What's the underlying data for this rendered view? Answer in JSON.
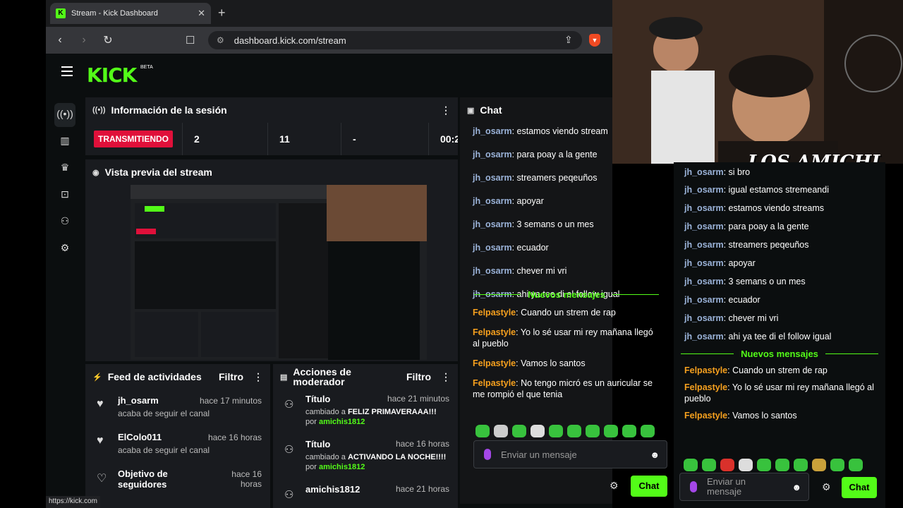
{
  "browser": {
    "tab_title": "Stream - Kick Dashboard",
    "url": "dashboard.kick.com/stream",
    "status_url": "https://kick.com"
  },
  "header": {
    "logo": "KICK",
    "beta": "BETA"
  },
  "session": {
    "title": "Información de la sesión",
    "live_label": "TRANSMITIENDO",
    "stat1": "2",
    "stat2": "11",
    "stat3": "-",
    "stat4": "00:2"
  },
  "preview": {
    "title": "Vista previa del stream"
  },
  "feed": {
    "title": "Feed de actividades",
    "filter": "Filtro",
    "items": [
      {
        "name": "jh_osarm",
        "time": "hace 17 minutos",
        "sub": "acaba de seguir el canal"
      },
      {
        "name": "ElColo011",
        "time": "hace 16 horas",
        "sub": "acaba de seguir el canal"
      },
      {
        "name": "Objetivo de seguidores",
        "time": "hace 16 horas",
        "sub": ""
      }
    ]
  },
  "mod": {
    "title": "Acciones de moderador",
    "filter": "Filtro",
    "items": [
      {
        "name": "Título",
        "time": "hace 21 minutos",
        "pre": "cambiado a ",
        "value": "FELIZ PRIMAVERAAA!!!",
        "by_pre": "por ",
        "by": "amichis1812"
      },
      {
        "name": "Título",
        "time": "hace 16 horas",
        "pre": "cambiado a ",
        "value": "ACTIVANDO LA NOCHE!!!!",
        "by_pre": " por ",
        "by": "amichis1812"
      }
    ],
    "partial_name": "amichis1812",
    "partial_time": "hace 21 horas"
  },
  "chat": {
    "title": "Chat",
    "messages": [
      {
        "user": "jh_osarm",
        "text": ": estamos viendo stream"
      },
      {
        "user": "jh_osarm",
        "text": ": para poay a la gente"
      },
      {
        "user": "jh_osarm",
        "text": ": streamers peqeuños"
      },
      {
        "user": "jh_osarm",
        "text": ": apoyar"
      },
      {
        "user": "jh_osarm",
        "text": ": 3 semans o un mes"
      },
      {
        "user": "jh_osarm",
        "text": ": ecuador"
      },
      {
        "user": "jh_osarm",
        "text": ": chever mi vri"
      },
      {
        "user": "jh_osarm",
        "text": ": ahi ya tee di el follow igual"
      }
    ],
    "new_label": "Nuevos mensajes",
    "new_messages": [
      {
        "user": "Felpastyle",
        "text": ": Cuando un strem de rap"
      },
      {
        "user": "Felpastyle",
        "text": ": Yo lo sé usar mi rey mañana llegó al pueblo"
      },
      {
        "user": "Felpastyle",
        "text": ": Vamos lo santos"
      },
      {
        "user": "Felpastyle",
        "text": ": No tengo micró es un auricular se me rompió el que tenia"
      }
    ],
    "placeholder": "Enviar un mensaje",
    "send": "Chat"
  },
  "overlay": {
    "title": "LOS AMICHI",
    "messages": [
      {
        "user": "jh_osarm",
        "text": ": si bro"
      },
      {
        "user": "jh_osarm",
        "text": ": igual estamos stremeandi"
      },
      {
        "user": "jh_osarm",
        "text": ": estamos viendo streams"
      },
      {
        "user": "jh_osarm",
        "text": ": para poay a la gente"
      },
      {
        "user": "jh_osarm",
        "text": ": streamers peqeuños"
      },
      {
        "user": "jh_osarm",
        "text": ": apoyar"
      },
      {
        "user": "jh_osarm",
        "text": ": 3 semans o un mes"
      },
      {
        "user": "jh_osarm",
        "text": ": ecuador"
      },
      {
        "user": "jh_osarm",
        "text": ": chever mi vri"
      },
      {
        "user": "jh_osarm",
        "text": ": ahi ya tee di el follow igual"
      }
    ],
    "new_label": "Nuevos mensajes",
    "new_messages": [
      {
        "user": "Felpastyle",
        "text": ": Cuando un strem de rap"
      },
      {
        "user": "Felpastyle",
        "text": ": Yo lo sé usar mi rey mañana llegó al pueblo"
      },
      {
        "user": "Felpastyle",
        "text": ": Vamos lo santos"
      }
    ],
    "placeholder": "Enviar un mensaje",
    "send": "Chat"
  },
  "colors": {
    "accent": "#53fc18",
    "live": "#e0103a",
    "user_blue": "#9bb3d9",
    "user_orange": "#f6a01e"
  }
}
